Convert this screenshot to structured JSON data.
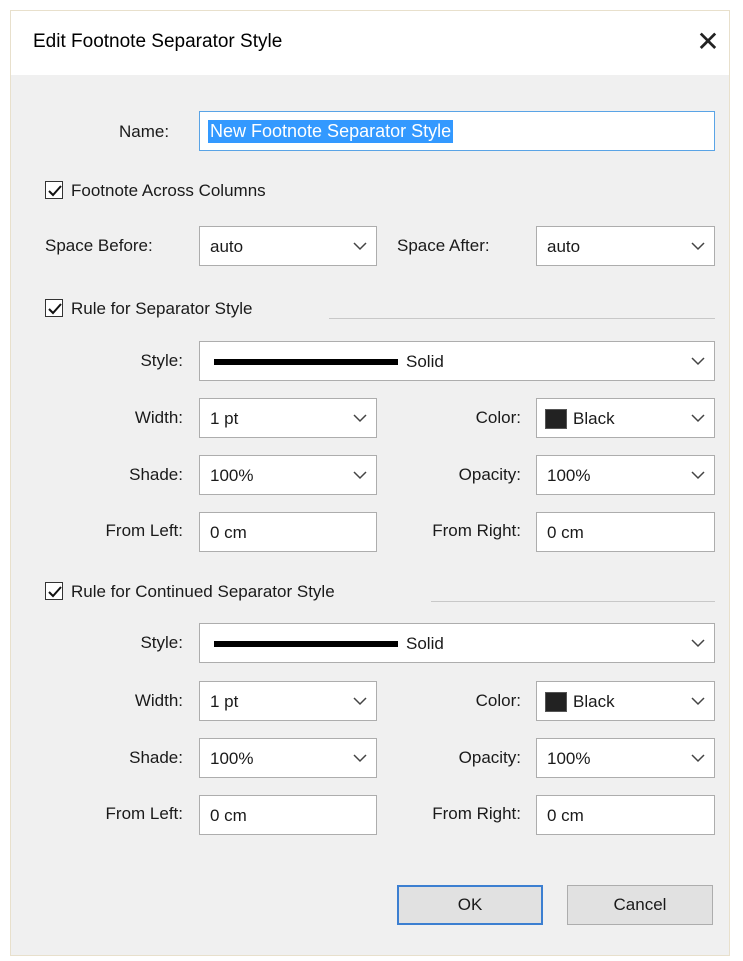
{
  "window": {
    "title": "Edit Footnote Separator Style",
    "close_label": "✕"
  },
  "name": {
    "label": "Name:",
    "value": "New Footnote Separator Style"
  },
  "footnote_across_columns": {
    "label": "Footnote Across Columns",
    "checked": true
  },
  "spacing": {
    "before_label": "Space Before:",
    "before_value": "auto",
    "after_label": "Space After:",
    "after_value": "auto"
  },
  "separator": {
    "header": "Rule for Separator Style",
    "checked": true,
    "style_label": "Style:",
    "style_value": "Solid",
    "width_label": "Width:",
    "width_value": "1 pt",
    "color_label": "Color:",
    "color_value": "Black",
    "color_hex": "#222222",
    "shade_label": "Shade:",
    "shade_value": "100%",
    "opacity_label": "Opacity:",
    "opacity_value": "100%",
    "from_left_label": "From Left:",
    "from_left_value": "0 cm",
    "from_right_label": "From Right:",
    "from_right_value": "0 cm"
  },
  "continued": {
    "header": "Rule for Continued Separator Style",
    "checked": true,
    "style_label": "Style:",
    "style_value": "Solid",
    "width_label": "Width:",
    "width_value": "1 pt",
    "color_label": "Color:",
    "color_value": "Black",
    "color_hex": "#222222",
    "shade_label": "Shade:",
    "shade_value": "100%",
    "opacity_label": "Opacity:",
    "opacity_value": "100%",
    "from_left_label": "From Left:",
    "from_left_value": "0 cm",
    "from_right_label": "From Right:",
    "from_right_value": "0 cm"
  },
  "buttons": {
    "ok": "OK",
    "cancel": "Cancel"
  },
  "icons": {
    "checkmark": "checkmark-icon",
    "dropdown": "chevron-down-icon",
    "close": "close-icon"
  }
}
